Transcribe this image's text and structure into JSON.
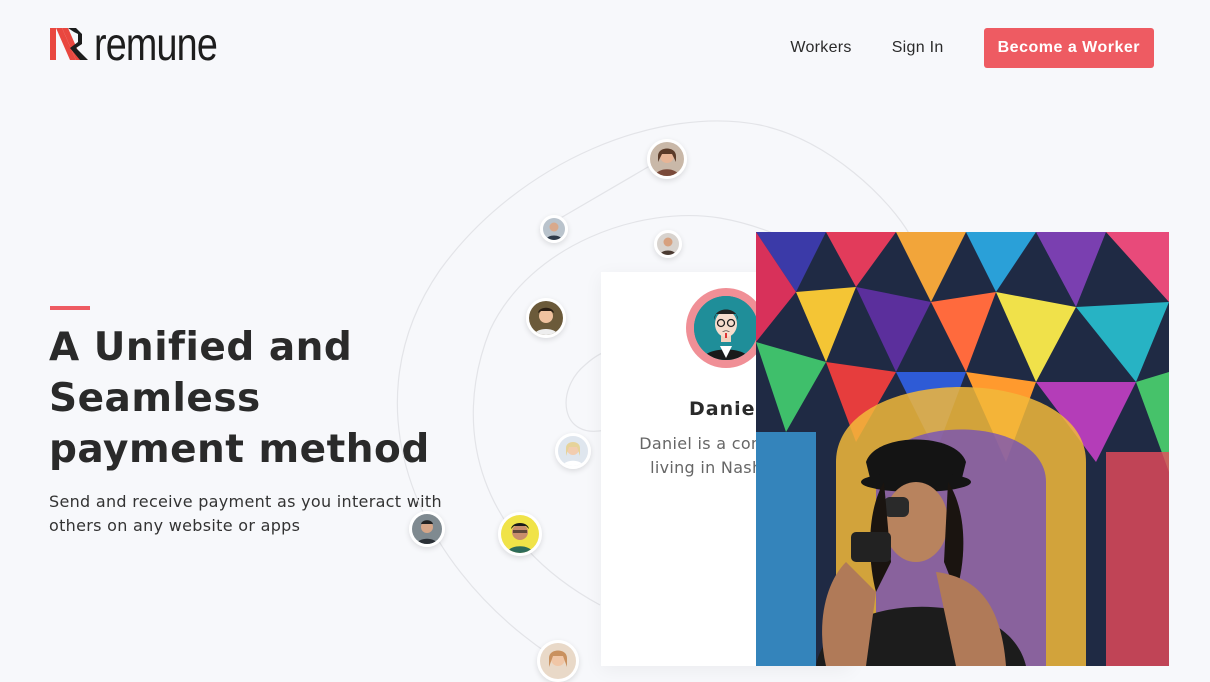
{
  "brand": {
    "name": "remune",
    "accent_color": "#ee5b62"
  },
  "nav": {
    "links": [
      "Workers",
      "Sign In"
    ],
    "cta_label": "Become a Worker"
  },
  "hero": {
    "headline": "A Unified and Seamless payment method",
    "subtext": "Send and receive payment as you interact with others on any website or apps"
  },
  "profile_card": {
    "name": "Daniel",
    "description": "Daniel is a comedian living in Nashville."
  },
  "icons": [
    "remune-logo-icon",
    "daniel-avatar-icon"
  ]
}
